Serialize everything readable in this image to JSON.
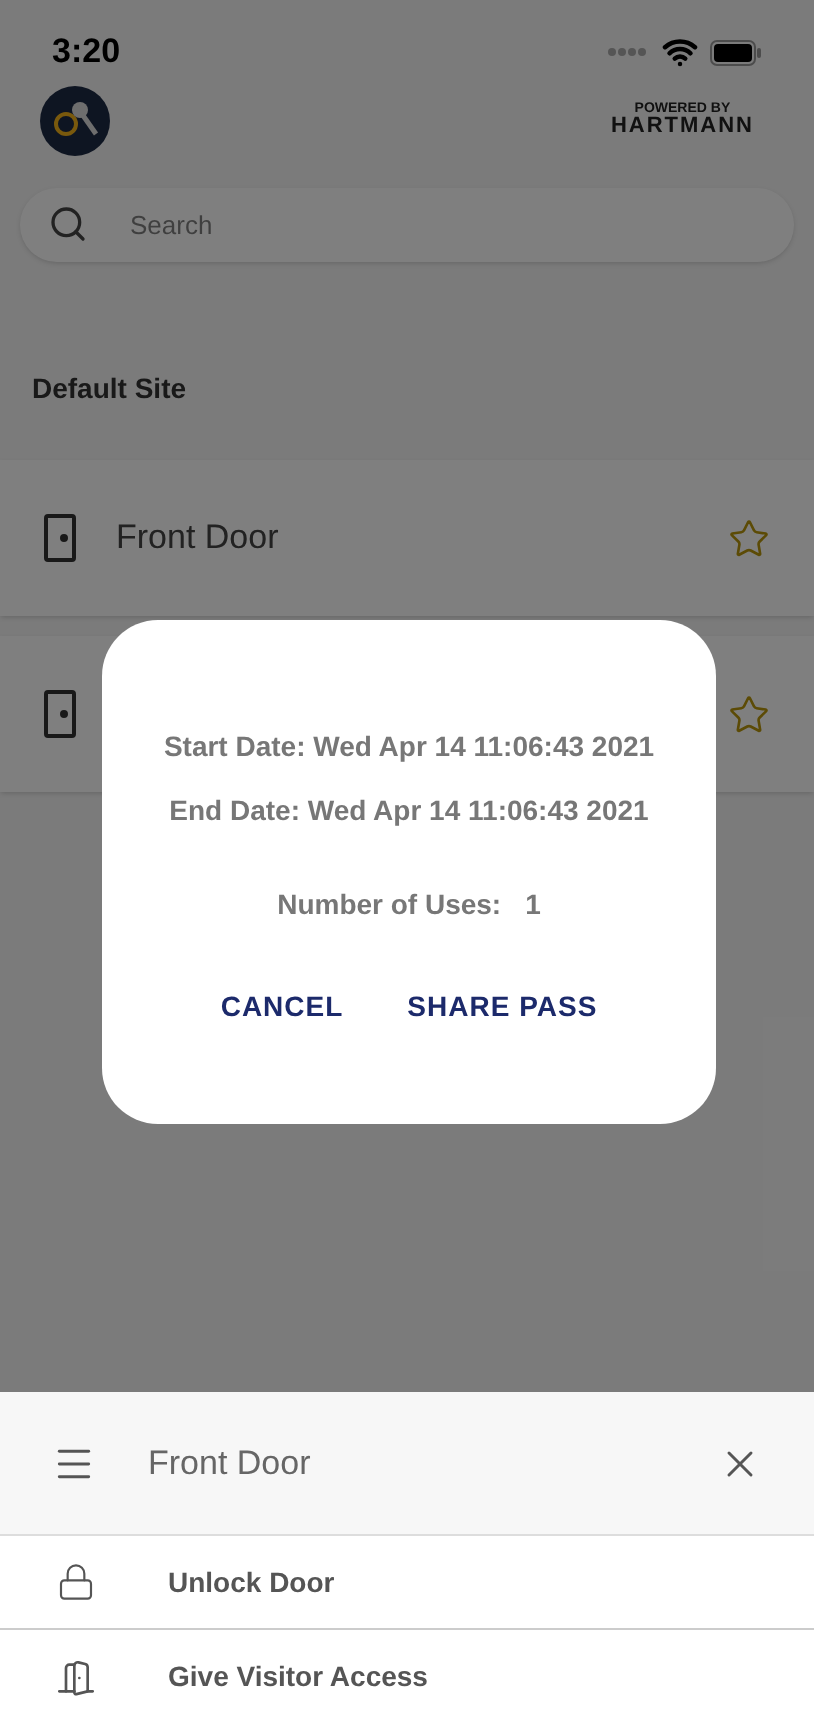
{
  "status_bar": {
    "time": "3:20"
  },
  "header": {
    "powered_by": "POWERED BY",
    "brand": "HARTMANN"
  },
  "search": {
    "placeholder": "Search"
  },
  "site": {
    "title": "Default Site"
  },
  "doors": [
    {
      "name": "Front Door",
      "favorite": false
    },
    {
      "favorite": false
    }
  ],
  "dialog": {
    "start": "Start Date: Wed Apr 14 11:06:43 2021",
    "end": "End Date: Wed Apr 14 11:06:43 2021",
    "uses_label": "Number of Uses:",
    "uses_value": "1",
    "buttons": [
      "CANCEL",
      "SHARE PASS"
    ]
  },
  "sheet": {
    "title": "Front Door",
    "actions": [
      {
        "kind": "lock",
        "label": "Unlock Door"
      },
      {
        "kind": "door",
        "label": "Give Visitor Access"
      }
    ]
  }
}
